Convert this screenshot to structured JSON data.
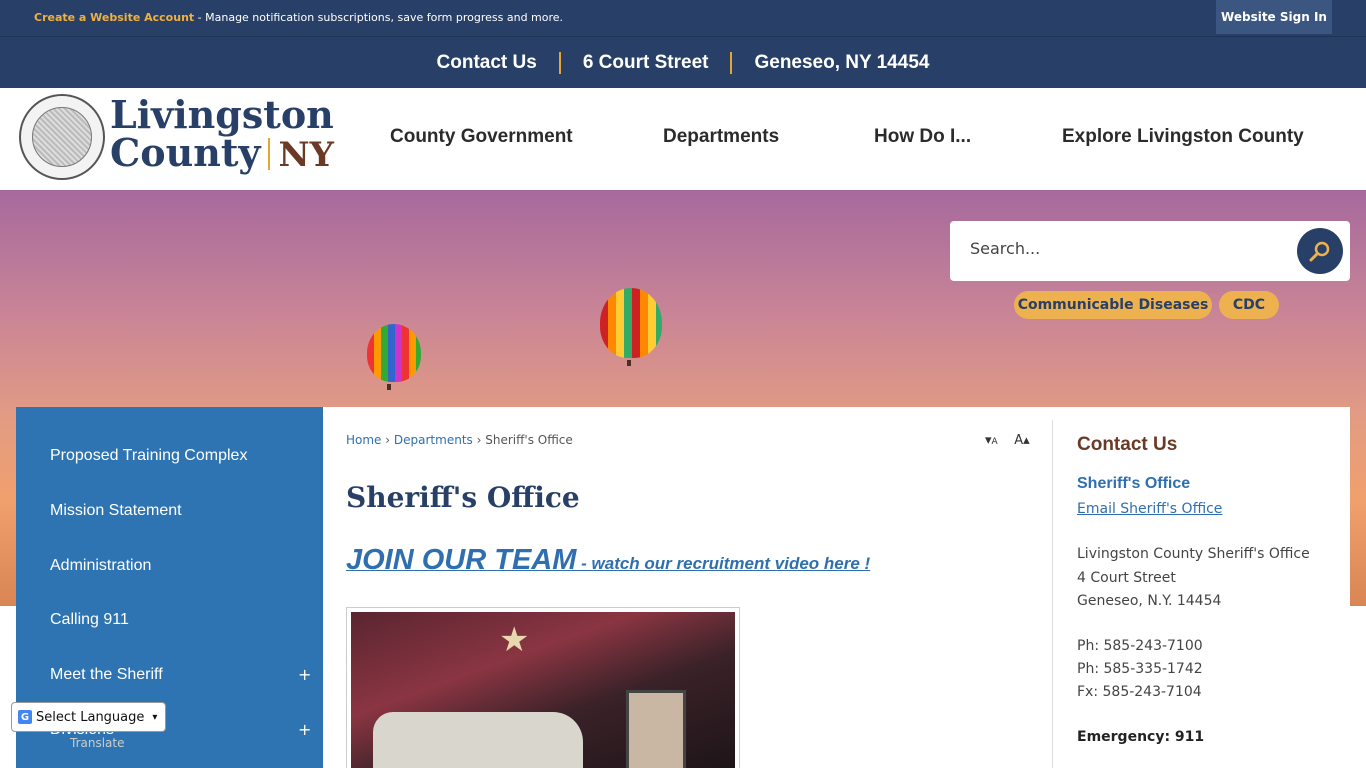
{
  "topbar": {
    "create_account": "Create a Website Account",
    "create_account_desc": " - Manage notification subscriptions, save form progress and more.",
    "sign_in": "Website Sign In"
  },
  "contact_bar": {
    "items": [
      "Contact Us",
      "6 Court Street",
      "Geneseo, NY 14454"
    ]
  },
  "logo": {
    "line1": "Livingston",
    "line2": "County",
    "state": "NY"
  },
  "nav": {
    "items": [
      "County Government",
      "Departments",
      "How Do I...",
      "Explore Livingston County"
    ]
  },
  "search": {
    "placeholder": "Search..."
  },
  "quick_links": [
    "Communicable Diseases",
    "CDC"
  ],
  "sidebar": {
    "items": [
      {
        "label": "Proposed Training Complex",
        "expandable": false
      },
      {
        "label": "Mission Statement",
        "expandable": false
      },
      {
        "label": "Administration",
        "expandable": false
      },
      {
        "label": "Calling 911",
        "expandable": false
      },
      {
        "label": "Meet the Sheriff",
        "expandable": true
      },
      {
        "label": "Divisions",
        "expandable": true
      }
    ],
    "expand_symbol": "+"
  },
  "breadcrumb": {
    "home": "Home",
    "departments": "Departments",
    "current": "Sheriff's Office",
    "sep": "›"
  },
  "font_resize": {
    "decrease": "A",
    "increase": "A"
  },
  "page": {
    "title": "Sheriff's Office",
    "join_big": "JOIN OUR TEAM",
    "join_small": " - watch our recruitment video here !"
  },
  "contact": {
    "heading": "Contact Us",
    "name": "Sheriff's Office",
    "email": "Email Sheriff's Office",
    "address1": "Livingston County Sheriff's Office",
    "address2": "4 Court Street",
    "address3": "Geneseo, N.Y. 14454",
    "phone1": "Ph: 585-243-7100",
    "phone2": "Ph: 585-335-1742",
    "fax": "Fx: 585-243-7104",
    "emergency": "Emergency: 911"
  },
  "translate": {
    "select_label": "Select Language",
    "powered": "Translate"
  },
  "colors": {
    "navy": "#284067",
    "gold": "#e4a734",
    "sidebar_blue": "#2f74b2",
    "link_blue": "#2f6fb0"
  }
}
